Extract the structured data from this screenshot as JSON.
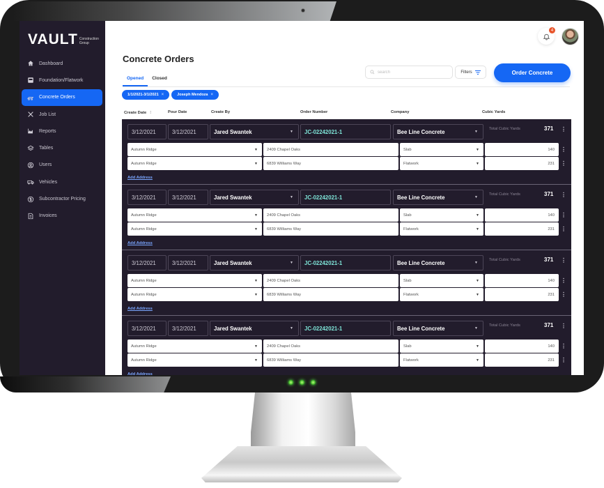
{
  "app": {
    "logo_word": "VAULT",
    "logo_sub_line1": "Construction",
    "logo_sub_line2": "Group"
  },
  "sidebar": {
    "items": [
      {
        "label": "Dashboard",
        "icon": "home-icon",
        "active": false
      },
      {
        "label": "Foundation/Flatwork",
        "icon": "foundation-icon",
        "active": false
      },
      {
        "label": "Concrete Orders",
        "icon": "concrete-truck-icon",
        "active": true
      },
      {
        "label": "Job List",
        "icon": "tools-icon",
        "active": false
      },
      {
        "label": "Reports",
        "icon": "chart-icon",
        "active": false
      },
      {
        "label": "Tables",
        "icon": "layers-icon",
        "active": false
      },
      {
        "label": "Users",
        "icon": "user-circle-icon",
        "active": false
      },
      {
        "label": "Vehicles",
        "icon": "vehicle-icon",
        "active": false
      },
      {
        "label": "Subcontractor Pricing",
        "icon": "dollar-circle-icon",
        "active": false
      },
      {
        "label": "Invoices",
        "icon": "invoice-icon",
        "active": false
      }
    ]
  },
  "topbar": {
    "notification_count": "4"
  },
  "header": {
    "title": "Concrete Orders",
    "tabs": [
      {
        "label": "Opened",
        "active": true
      },
      {
        "label": "Closed",
        "active": false
      }
    ],
    "chips": [
      {
        "label": "1/1/2021-3/1/2021"
      },
      {
        "label": "Joseph Mendoza"
      }
    ],
    "search_placeholder": "search",
    "filters_label": "Filters",
    "order_button_label": "Order Concrete"
  },
  "columns": [
    "Create Date",
    "Pour Date",
    "Create By",
    "Order Number",
    "Company",
    "Cubic Yards"
  ],
  "orders": [
    {
      "create_date": "3/12/2021",
      "pour_date": "3/12/2021",
      "created_by": "Jared Swantek",
      "order_number": "JC-02242021-1",
      "company": "Bee Line Concrete",
      "total_label": "Total Cubic Yards",
      "total": "371",
      "lines": [
        {
          "job": "Autumn Ridge",
          "address": "2409 Chapel Oaks",
          "type": "Slab",
          "yards": "140"
        },
        {
          "job": "Autumn Ridge",
          "address": "6839 Williams Way",
          "type": "Flatwork",
          "yards": "231"
        }
      ],
      "add_address_label": "Add Address"
    },
    {
      "create_date": "3/12/2021",
      "pour_date": "3/12/2021",
      "created_by": "Jared Swantek",
      "order_number": "JC-02242021-1",
      "company": "Bee Line Concrete",
      "total_label": "Total Cubic Yards",
      "total": "371",
      "lines": [
        {
          "job": "Autumn Ridge",
          "address": "2409 Chapel Oaks",
          "type": "Slab",
          "yards": "140"
        },
        {
          "job": "Autumn Ridge",
          "address": "6839 Williams Way",
          "type": "Flatwork",
          "yards": "231"
        }
      ],
      "add_address_label": "Add Address"
    },
    {
      "create_date": "3/12/2021",
      "pour_date": "3/12/2021",
      "created_by": "Jared Swantek",
      "order_number": "JC-02242021-1",
      "company": "Bee Line Concrete",
      "total_label": "Total Cubic Yards",
      "total": "371",
      "lines": [
        {
          "job": "Autumn Ridge",
          "address": "2409 Chapel Oaks",
          "type": "Slab",
          "yards": "140"
        },
        {
          "job": "Autumn Ridge",
          "address": "6839 Williams Way",
          "type": "Flatwork",
          "yards": "231"
        }
      ],
      "add_address_label": "Add Address"
    },
    {
      "create_date": "3/12/2021",
      "pour_date": "3/12/2021",
      "created_by": "Jared Swantek",
      "order_number": "JC-02242021-1",
      "company": "Bee Line Concrete",
      "total_label": "Total Cubic Yards",
      "total": "371",
      "lines": [
        {
          "job": "Autumn Ridge",
          "address": "2409 Chapel Oaks",
          "type": "Slab",
          "yards": "140"
        },
        {
          "job": "Autumn Ridge",
          "address": "6839 Williams Way",
          "type": "Flatwork",
          "yards": "231"
        }
      ],
      "add_address_label": "Add Address"
    }
  ],
  "colors": {
    "accent": "#1567f4",
    "sidebar_bg": "#221c2c",
    "order_number": "#7fe6d9",
    "badge": "#e8542a"
  }
}
